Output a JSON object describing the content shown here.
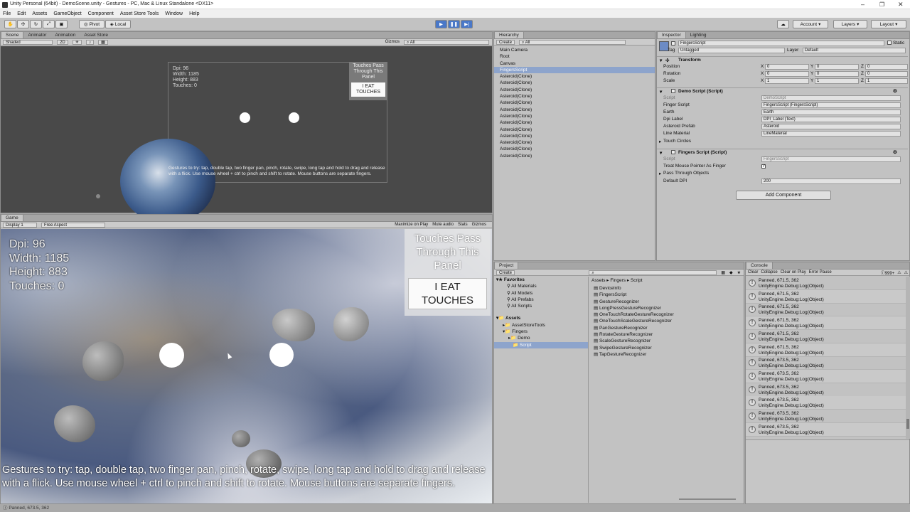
{
  "window": {
    "title": "Unity Personal (64bit) - DemoScene.unity - Gestures - PC, Mac & Linux Standalone <DX11>"
  },
  "menu": [
    "File",
    "Edit",
    "Assets",
    "GameObject",
    "Component",
    "Asset Store Tools",
    "Window",
    "Help"
  ],
  "toolbar": {
    "pivot": "Pivot",
    "local": "Local",
    "account": "Account",
    "layers": "Layers",
    "layout": "Layout"
  },
  "scene": {
    "tabs": [
      "Scene",
      "Animator",
      "Animation",
      "Asset Store"
    ],
    "shading": "Shaded",
    "mode2d": "2D",
    "gizmos": "Gizmos",
    "search": "All",
    "overlay": {
      "dpi": "Dpi: 96",
      "width": "Width: 1185",
      "height": "Height: 883",
      "touches": "Touches: 0"
    },
    "panel_text": "Touches Pass Through This Panel",
    "eat_button": "I EAT TOUCHES",
    "instructions": "Gestures to try: tap, double tap, two finger pan, pinch, rotate, swipe, long tap and hold to drag and release with a flick. Use mouse wheel + ctrl to pinch and shift to rotate. Mouse buttons are separate fingers."
  },
  "game": {
    "tab": "Game",
    "display": "Display 1",
    "aspect": "Free Aspect",
    "maximize": "Maximize on Play",
    "mute": "Mute audio",
    "stats": "Stats",
    "gizmos": "Gizmos",
    "overlay": {
      "dpi": "Dpi: 96",
      "width": "Width: 1185",
      "height": "Height: 883",
      "touches": "Touches: 0"
    },
    "panel_text": "Touches Pass Through This Panel",
    "eat_button": "I EAT TOUCHES",
    "instructions": "Gestures to try: tap, double tap, two finger pan, pinch, rotate, swipe, long tap and hold to drag and release with a flick. Use mouse wheel + ctrl to pinch and shift to rotate. Mouse buttons are separate fingers."
  },
  "hierarchy": {
    "tab": "Hierarchy",
    "create": "Create",
    "search": "All",
    "items": [
      "Main Camera",
      "Root",
      "Canvas",
      "FingersScript",
      "Asteroid(Clone)",
      "Asteroid(Clone)",
      "Asteroid(Clone)",
      "Asteroid(Clone)",
      "Asteroid(Clone)",
      "Asteroid(Clone)",
      "Asteroid(Clone)",
      "Asteroid(Clone)",
      "Asteroid(Clone)",
      "Asteroid(Clone)",
      "Asteroid(Clone)",
      "Asteroid(Clone)",
      "Asteroid(Clone)"
    ]
  },
  "inspector": {
    "tabs": [
      "Inspector",
      "Lighting"
    ],
    "object_name": "FingersScript",
    "static": "Static",
    "tag_label": "Tag",
    "tag": "Untagged",
    "layer_label": "Layer",
    "layer": "Default",
    "transform": {
      "title": "Transform",
      "position": "Position",
      "rotation": "Rotation",
      "scale": "Scale",
      "pos": [
        "0",
        "0",
        "0"
      ],
      "rot": [
        "0",
        "0",
        "0"
      ],
      "scl": [
        "1",
        "1",
        "1"
      ],
      "x": "X",
      "y": "Y",
      "z": "Z"
    },
    "demo": {
      "title": "Demo Script (Script)",
      "script_label": "Script",
      "script": "DemoScript",
      "finger_label": "Finger Script",
      "finger": "FingersScript (FingersScript)",
      "earth_label": "Earth",
      "earth": "Earth",
      "dpi_label": "Dpi Label",
      "dpi": "DPI_Label (Text)",
      "asteroid_label": "Asteroid Prefab",
      "asteroid": "Asteroid",
      "line_label": "Line Material",
      "line": "LineMaterial",
      "touch_circles": "Touch Circles"
    },
    "fingers": {
      "title": "Fingers Script (Script)",
      "script_label": "Script",
      "script": "FingersScript",
      "treat": "Treat Mouse Pointer As Finger",
      "pass": "Pass Through Objects",
      "dpi_label": "Default DPI",
      "dpi": "200"
    },
    "add_component": "Add Component"
  },
  "project": {
    "tab": "Project",
    "create": "Create",
    "favorites": "Favorites",
    "fav_items": [
      "All Materials",
      "All Models",
      "All Prefabs",
      "All Scripts"
    ],
    "assets": "Assets",
    "tree": [
      "AssetStoreTools",
      "Fingers",
      "Demo",
      "Script"
    ],
    "breadcrumb": "Assets ▸ Fingers ▸ Script",
    "files": [
      "DeviceInfo",
      "FingersScript",
      "GestureRecognizer",
      "LongPressGestureRecognizer",
      "OneTouchRotateGestureRecognizer",
      "OneTouchScaleGestureRecognizer",
      "PanGestureRecognizer",
      "RotateGestureRecognizer",
      "ScaleGestureRecognizer",
      "SwipeGestureRecognizer",
      "TapGestureRecognizer"
    ]
  },
  "console": {
    "tab": "Console",
    "clear": "Clear",
    "collapse": "Collapse",
    "clear_on_play": "Clear on Play",
    "error_pause": "Error Pause",
    "count": "999+",
    "entries": [
      {
        "l1": "Panned, 671.5, 362",
        "l2": "UnityEngine.Debug:Log(Object)"
      },
      {
        "l1": "Panned, 671.5, 362",
        "l2": "UnityEngine.Debug:Log(Object)"
      },
      {
        "l1": "Panned, 671.5, 362",
        "l2": "UnityEngine.Debug:Log(Object)"
      },
      {
        "l1": "Panned, 671.5, 362",
        "l2": "UnityEngine.Debug:Log(Object)"
      },
      {
        "l1": "Panned, 671.5, 362",
        "l2": "UnityEngine.Debug:Log(Object)"
      },
      {
        "l1": "Panned, 671.5, 362",
        "l2": "UnityEngine.Debug:Log(Object)"
      },
      {
        "l1": "Panned, 673.5, 362",
        "l2": "UnityEngine.Debug:Log(Object)"
      },
      {
        "l1": "Panned, 673.5, 362",
        "l2": "UnityEngine.Debug:Log(Object)"
      },
      {
        "l1": "Panned, 673.5, 362",
        "l2": "UnityEngine.Debug:Log(Object)"
      },
      {
        "l1": "Panned, 673.5, 362",
        "l2": "UnityEngine.Debug:Log(Object)"
      },
      {
        "l1": "Panned, 673.5, 362",
        "l2": "UnityEngine.Debug:Log(Object)"
      },
      {
        "l1": "Panned, 673.5, 362",
        "l2": "UnityEngine.Debug:Log(Object)"
      }
    ]
  },
  "status": "Panned, 673.5, 362"
}
